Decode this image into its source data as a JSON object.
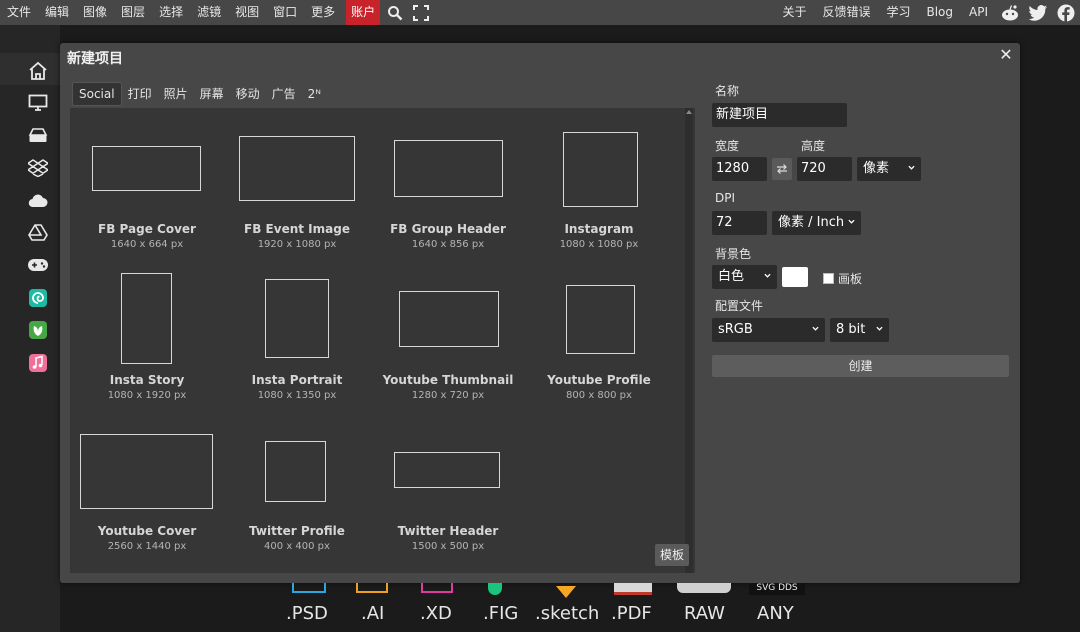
{
  "menu": {
    "items": [
      "文件",
      "编辑",
      "图像",
      "图层",
      "选择",
      "滤镜",
      "视图",
      "窗口",
      "更多"
    ],
    "account": "账户",
    "right": [
      "关于",
      "反馈错误",
      "学习",
      "Blog",
      "API"
    ]
  },
  "dialog": {
    "title": "新建项目",
    "tabs": [
      "Social",
      "打印",
      "照片",
      "屏幕",
      "移动",
      "广告",
      "2ᴺ"
    ],
    "templates_button": "模板",
    "templates": [
      {
        "name": "FB Page Cover",
        "size": "1640 x 664 px"
      },
      {
        "name": "FB Event Image",
        "size": "1920 x 1080 px"
      },
      {
        "name": "FB Group Header",
        "size": "1640 x 856 px"
      },
      {
        "name": "Instagram",
        "size": "1080 x 1080 px"
      },
      {
        "name": "Insta Story",
        "size": "1080 x 1920 px"
      },
      {
        "name": "Insta Portrait",
        "size": "1080 x 1350 px"
      },
      {
        "name": "Youtube Thumbnail",
        "size": "1280 x 720 px"
      },
      {
        "name": "Youtube Profile",
        "size": "800 x 800 px"
      },
      {
        "name": "Youtube Cover",
        "size": "2560 x 1440 px"
      },
      {
        "name": "Twitter Profile",
        "size": "400 x 400 px"
      },
      {
        "name": "Twitter Header",
        "size": "1500 x 500 px"
      }
    ],
    "form": {
      "name_label": "名称",
      "name_value": "新建项目",
      "width_label": "宽度",
      "width_value": "1280",
      "height_label": "高度",
      "height_value": "720",
      "unit": "像素",
      "dpi_label": "DPI",
      "dpi_value": "72",
      "dpi_unit": "像素 / Inch",
      "bg_label": "背景色",
      "bg_value": "白色",
      "bg_color": "#ffffff",
      "artboard_label": "画板",
      "profile_label": "配置文件",
      "profile_value": "sRGB",
      "bit_depth": "8 bit",
      "create_label": "创建"
    }
  },
  "formats": [
    ".PSD",
    ".AI",
    ".XD",
    ".FIG",
    ".sketch",
    ".PDF",
    "RAW",
    "ANY"
  ],
  "colors": {
    "menubar": "#474747",
    "account": "#c8222a",
    "dialog": "#474747",
    "panel": "#363636"
  }
}
